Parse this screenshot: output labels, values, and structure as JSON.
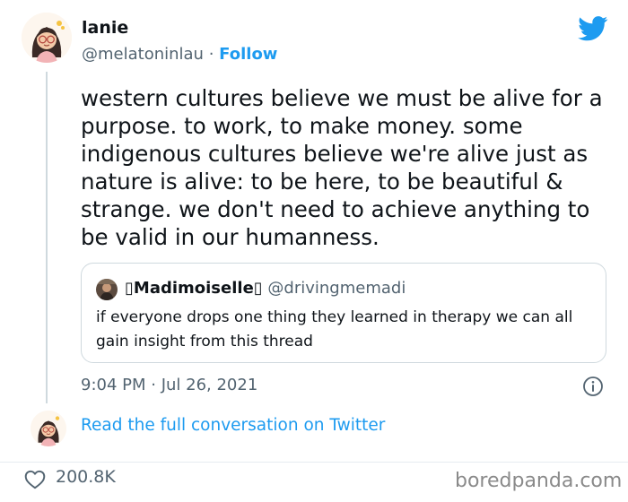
{
  "author": {
    "name": "lanie",
    "handle": "@melatoninlau",
    "separator": "·",
    "follow_label": "Follow"
  },
  "tweet": {
    "text": "western cultures believe we must be alive for a purpose. to work, to make money. some indigenous cultures believe we're alive just as nature is alive: to be here, to be beautiful & strange. we don't need to achieve anything to be valid in our humanness.",
    "timestamp": "9:04 PM · Jul 26, 2021"
  },
  "quote": {
    "name": "▯Madimoiselle▯",
    "handle": "@drivingmemadi",
    "text": "if everyone drops one thing they learned in therapy we can all gain insight from this thread"
  },
  "thread": {
    "read_full_label": "Read the full conversation on Twitter"
  },
  "stats": {
    "likes": "200.8K"
  },
  "watermark": "boredpanda.com",
  "icons": {
    "brand": "twitter-bird-icon",
    "info": "info-icon",
    "like": "heart-icon"
  },
  "colors": {
    "brand": "#1d9bf0",
    "text": "#0f1419",
    "muted": "#536471",
    "border": "#cfd9de"
  }
}
